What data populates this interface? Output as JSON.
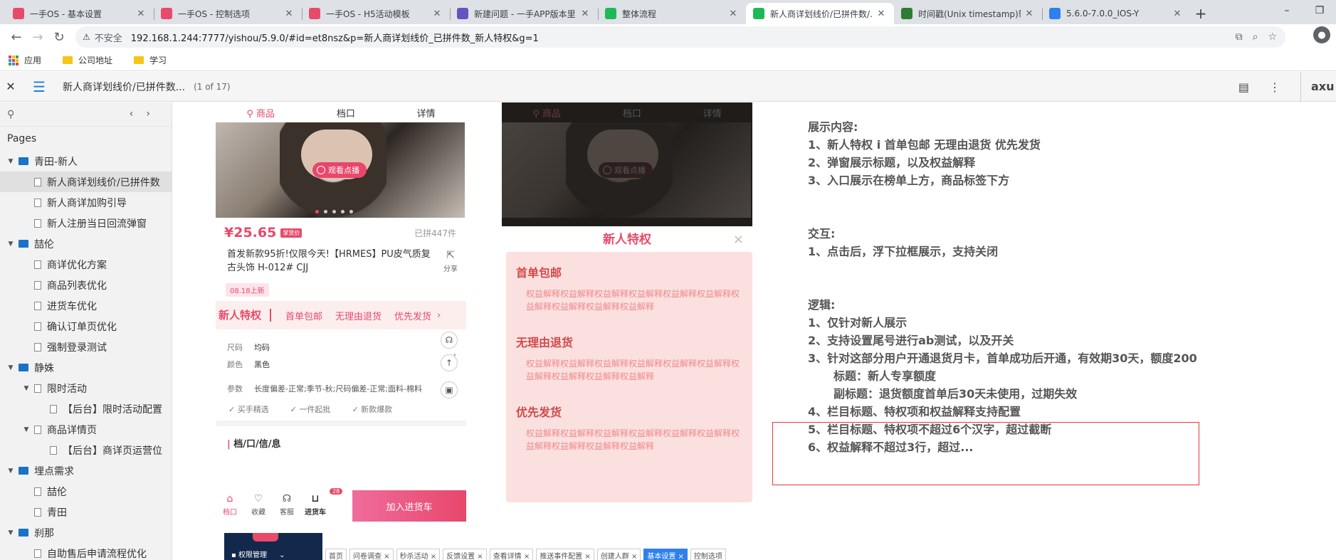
{
  "browser": {
    "tabs": [
      {
        "title": "一手OS - 基本设置",
        "icon": "yishou-icon",
        "color": "#e84a6a",
        "active": false
      },
      {
        "title": "一手OS - 控制选项",
        "icon": "yishou-icon",
        "color": "#e84a6a",
        "active": false
      },
      {
        "title": "一手OS - H5活动模板",
        "icon": "yishou-icon",
        "color": "#e84a6a",
        "active": false
      },
      {
        "title": "新建问题 - 一手APP版本里",
        "icon": "jira-icon",
        "color": "#6554c0",
        "active": false
      },
      {
        "title": "整体流程",
        "icon": "axure-icon",
        "color": "#1db954",
        "active": false
      },
      {
        "title": "新人商详划线价/已拼件数/...",
        "icon": "axure-icon",
        "color": "#1db954",
        "active": true
      },
      {
        "title": "时间戳(Unix timestamp)转",
        "icon": "timestamp-icon",
        "color": "#2e7d32",
        "active": false
      },
      {
        "title": "5.6.0-7.0.0_IOS-Y",
        "icon": "doc-icon",
        "color": "#2f80ed",
        "active": false
      }
    ],
    "new_tab": "+",
    "window_controls": [
      "–",
      "❐"
    ],
    "security_label": "不安全",
    "url": "192.168.1.244:7777/yishou/5.9.0/#id=et8nsz&p=新人商详划线价_已拼件数_新人特权&g=1",
    "bookmarks": [
      {
        "label": "应用",
        "icon": "apps-icon"
      },
      {
        "label": "公司地址",
        "icon": "folder-icon"
      },
      {
        "label": "学习",
        "icon": "folder-icon"
      }
    ]
  },
  "axure": {
    "page_title": "新人商详划线价/已拼件数...",
    "page_count": "(1 of 17)",
    "logo": "axu"
  },
  "sidebar": {
    "pages_label": "Pages",
    "tree": [
      {
        "type": "folder",
        "label": "青田-新人",
        "level": 0,
        "expanded": true
      },
      {
        "type": "page",
        "label": "新人商详划线价/已拼件数",
        "level": 1,
        "selected": true
      },
      {
        "type": "page",
        "label": "新人商详加购引导",
        "level": 1
      },
      {
        "type": "page",
        "label": "新人注册当日回流弹窗",
        "level": 1
      },
      {
        "type": "folder",
        "label": "喆伦",
        "level": 0,
        "expanded": true
      },
      {
        "type": "page",
        "label": "商详优化方案",
        "level": 1
      },
      {
        "type": "page",
        "label": "商品列表优化",
        "level": 1
      },
      {
        "type": "page",
        "label": "进货车优化",
        "level": 1
      },
      {
        "type": "page",
        "label": "确认订单页优化",
        "level": 1
      },
      {
        "type": "page",
        "label": "强制登录测试",
        "level": 1
      },
      {
        "type": "folder",
        "label": "静姝",
        "level": 0,
        "expanded": true
      },
      {
        "type": "page-parent",
        "label": "限时活动",
        "level": 1,
        "expanded": true
      },
      {
        "type": "page",
        "label": "【后台】限时活动配置",
        "level": 2
      },
      {
        "type": "page-parent",
        "label": "商品详情页",
        "level": 1,
        "expanded": true
      },
      {
        "type": "page",
        "label": "【后台】商详页运营位",
        "level": 2
      },
      {
        "type": "folder",
        "label": "埋点需求",
        "level": 0,
        "expanded": true
      },
      {
        "type": "page",
        "label": "喆伦",
        "level": 1
      },
      {
        "type": "page",
        "label": "青田",
        "level": 1
      },
      {
        "type": "folder",
        "label": "刹那",
        "level": 0,
        "expanded": true
      },
      {
        "type": "page",
        "label": "自助售后申请流程优化",
        "level": 1
      }
    ]
  },
  "mock_product": {
    "tabs": [
      "商品",
      "档口",
      "详情"
    ],
    "play_label": "观看点播",
    "price": "¥25.65",
    "price_tag": "掌货价",
    "sold": "已拼447件",
    "title": "首发新款95折!仅限今天!【HRMES】PU皮气质复古头饰  H-012#  CJJ",
    "share": "分享",
    "new_tag": "08.18上新",
    "privilege_main": "新人特权",
    "privileges": [
      "首单包邮",
      "无理由退货",
      "优先发货"
    ],
    "spec_rows": [
      {
        "k": "尺码",
        "v": "均码"
      },
      {
        "k": "颜色",
        "v": "黑色"
      }
    ],
    "params_k": "参数",
    "params_v": "长度偏差-正常;季节-秋;尺码偏差-正常;面料-棉料",
    "feature_tags": [
      "买手精选",
      "一件起批",
      "新款爆款"
    ],
    "info_heading": "档/口/信/息",
    "bottom_items": [
      {
        "label": "档口",
        "icon": "store-icon"
      },
      {
        "label": "收藏",
        "icon": "heart-icon"
      },
      {
        "label": "客服",
        "icon": "headset-icon"
      },
      {
        "label": "进货车",
        "icon": "cart-icon"
      }
    ],
    "cart_badge": "28",
    "add_cart": "加入进货车"
  },
  "backend_strip": {
    "side_label": "权限管理",
    "tabs": [
      {
        "label": "首页",
        "active": false
      },
      {
        "label": "问卷调查 ×",
        "active": false
      },
      {
        "label": "秒杀活动 ×",
        "active": false
      },
      {
        "label": "反馈设置 ×",
        "active": false
      },
      {
        "label": "查看详情 ×",
        "active": false
      },
      {
        "label": "推送事件配置 ×",
        "active": false
      },
      {
        "label": "创建人群 ×",
        "active": false
      },
      {
        "label": "基本设置 ×",
        "active": true
      },
      {
        "label": "控制选项",
        "active": false
      }
    ]
  },
  "popup": {
    "title": "新人特权",
    "close": "×",
    "blocks": [
      {
        "title": "首单包邮",
        "desc": "权益解释权益解释权益解释权益解释权益解释权益解释权益解释权益解释权益解释权益解释"
      },
      {
        "title": "无理由退货",
        "desc": "权益解释权益解释权益解释权益解释权益解释权益解释权益解释权益解释权益解释权益解释"
      },
      {
        "title": "优先发货",
        "desc": "权益解释权益解释权益解释权益解释权益解释权益解释权益解释权益解释权益解释权益解释"
      }
    ]
  },
  "notes": {
    "lines": [
      {
        "text": "展示内容:",
        "indent": false
      },
      {
        "text": "1、新人特权 i 首单包邮  无理由退货  优先发货",
        "indent": false
      },
      {
        "text": "2、弹窗展示标题，以及权益解释",
        "indent": false
      },
      {
        "text": "3、入口展示在榜单上方，商品标签下方",
        "indent": false
      },
      {
        "text": "",
        "indent": false
      },
      {
        "text": "",
        "indent": false
      },
      {
        "text": "交互:",
        "indent": false
      },
      {
        "text": "1、点击后，浮下拉框展示，支持关闭",
        "indent": false
      },
      {
        "text": "",
        "indent": false
      },
      {
        "text": "",
        "indent": false
      },
      {
        "text": "逻辑:",
        "indent": false
      },
      {
        "text": "1、仅针对新人展示",
        "indent": false
      },
      {
        "text": "2、支持设置尾号进行ab测试，以及开关",
        "indent": false
      },
      {
        "text": "3、针对这部分用户开通退货月卡，首单成功后开通，有效期30天，额度200",
        "indent": false
      },
      {
        "text": "标题：新人专享额度",
        "indent": true
      },
      {
        "text": "副标题：退货额度首单后30天未使用，过期失效",
        "indent": true
      },
      {
        "text": "4、栏目标题、特权项和权益解释支持配置",
        "indent": false
      },
      {
        "text": "5、栏目标题、特权项不超过6个汉字，超过截断",
        "indent": false
      },
      {
        "text": "6、权益解释不超过3行，超过...",
        "indent": false
      }
    ]
  },
  "colors": {
    "accent": "#e84a6a",
    "folder": "#1a73c6",
    "popup_bg": "#fbe0e0",
    "highlight_box": "#e53935"
  }
}
